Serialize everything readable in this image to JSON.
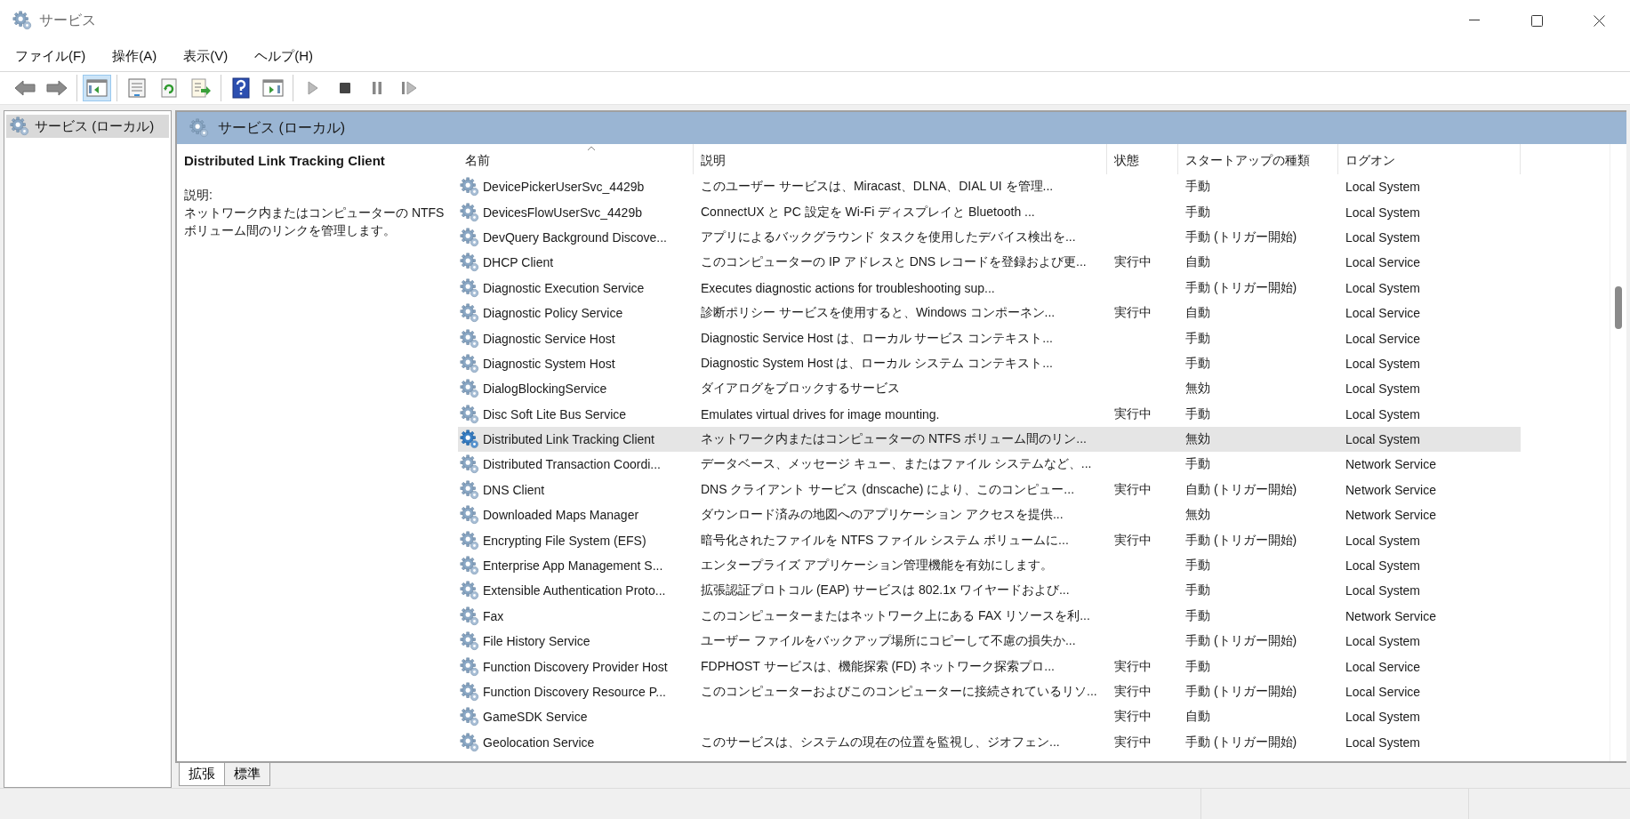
{
  "window": {
    "title": "サービス"
  },
  "menu": [
    "ファイル(F)",
    "操作(A)",
    "表示(V)",
    "ヘルプ(H)"
  ],
  "toolbar_groups": [
    {
      "buttons": [
        {
          "kind": "back",
          "pressed": false
        },
        {
          "kind": "forward",
          "pressed": false
        }
      ]
    },
    {
      "buttons": [
        {
          "kind": "console-tree",
          "pressed": true
        }
      ]
    },
    {
      "buttons": [
        {
          "kind": "properties",
          "pressed": false
        },
        {
          "kind": "refresh",
          "pressed": false
        },
        {
          "kind": "export",
          "pressed": false
        }
      ]
    },
    {
      "buttons": [
        {
          "kind": "help",
          "pressed": false
        },
        {
          "kind": "show-pane",
          "pressed": false
        }
      ]
    },
    {
      "buttons": [
        {
          "kind": "start",
          "pressed": false
        },
        {
          "kind": "stop",
          "pressed": false
        },
        {
          "kind": "pause",
          "pressed": false
        },
        {
          "kind": "resume",
          "pressed": false
        }
      ]
    }
  ],
  "tree": {
    "items": [
      {
        "label": "サービス (ローカル)",
        "selected": true
      }
    ]
  },
  "pane_header": "サービス (ローカル)",
  "details": {
    "title": "Distributed Link Tracking Client",
    "label": "説明:",
    "text": "ネットワーク内またはコンピューターの NTFS ボリューム間のリンクを管理します。"
  },
  "table": {
    "columns": [
      "名前",
      "説明",
      "状態",
      "スタートアップの種類",
      "ログオン"
    ],
    "rows": [
      {
        "name": "DevicePickerUserSvc_4429b",
        "description": "このユーザー サービスは、Miracast、DLNA、DIAL UI を管理...",
        "status": "",
        "startup": "手動",
        "logon": "Local System",
        "selected": false
      },
      {
        "name": "DevicesFlowUserSvc_4429b",
        "description": "ConnectUX と PC 設定を Wi-Fi ディスプレイと Bluetooth ...",
        "status": "",
        "startup": "手動",
        "logon": "Local System",
        "selected": false
      },
      {
        "name": "DevQuery Background Discove...",
        "description": "アプリによるバックグラウンド タスクを使用したデバイス検出を...",
        "status": "",
        "startup": "手動 (トリガー開始)",
        "logon": "Local System",
        "selected": false
      },
      {
        "name": "DHCP Client",
        "description": "このコンピューターの IP アドレスと DNS レコードを登録および更...",
        "status": "実行中",
        "startup": "自動",
        "logon": "Local Service",
        "selected": false
      },
      {
        "name": "Diagnostic Execution Service",
        "description": "Executes diagnostic actions for troubleshooting sup...",
        "status": "",
        "startup": "手動 (トリガー開始)",
        "logon": "Local System",
        "selected": false
      },
      {
        "name": "Diagnostic Policy Service",
        "description": "診断ポリシー サービスを使用すると、Windows コンポーネン...",
        "status": "実行中",
        "startup": "自動",
        "logon": "Local Service",
        "selected": false
      },
      {
        "name": "Diagnostic Service Host",
        "description": "Diagnostic Service Host は、ローカル サービス コンテキスト...",
        "status": "",
        "startup": "手動",
        "logon": "Local Service",
        "selected": false
      },
      {
        "name": "Diagnostic System Host",
        "description": "Diagnostic System Host は、ローカル システム コンテキスト...",
        "status": "",
        "startup": "手動",
        "logon": "Local System",
        "selected": false
      },
      {
        "name": "DialogBlockingService",
        "description": "ダイアログをブロックするサービス",
        "status": "",
        "startup": "無効",
        "logon": "Local System",
        "selected": false
      },
      {
        "name": "Disc Soft Lite Bus Service",
        "description": "Emulates virtual drives for image mounting.",
        "status": "実行中",
        "startup": "手動",
        "logon": "Local System",
        "selected": false
      },
      {
        "name": "Distributed Link Tracking Client",
        "description": "ネットワーク内またはコンピューターの NTFS ボリューム間のリン...",
        "status": "",
        "startup": "無効",
        "logon": "Local System",
        "selected": true
      },
      {
        "name": "Distributed Transaction Coordi...",
        "description": "データベース、メッセージ キュー、またはファイル システムなど、...",
        "status": "",
        "startup": "手動",
        "logon": "Network Service",
        "selected": false
      },
      {
        "name": "DNS Client",
        "description": "DNS クライアント サービス (dnscache) により、このコンピュー...",
        "status": "実行中",
        "startup": "自動 (トリガー開始)",
        "logon": "Network Service",
        "selected": false
      },
      {
        "name": "Downloaded Maps Manager",
        "description": "ダウンロード済みの地図へのアプリケーション アクセスを提供...",
        "status": "",
        "startup": "無効",
        "logon": "Network Service",
        "selected": false
      },
      {
        "name": "Encrypting File System (EFS)",
        "description": "暗号化されたファイルを NTFS ファイル システム ボリュームに...",
        "status": "実行中",
        "startup": "手動 (トリガー開始)",
        "logon": "Local System",
        "selected": false
      },
      {
        "name": "Enterprise App Management S...",
        "description": "エンタープライズ アプリケーション管理機能を有効にします。",
        "status": "",
        "startup": "手動",
        "logon": "Local System",
        "selected": false
      },
      {
        "name": "Extensible Authentication Proto...",
        "description": "拡張認証プロトコル (EAP) サービスは 802.1x ワイヤードおよび...",
        "status": "",
        "startup": "手動",
        "logon": "Local System",
        "selected": false
      },
      {
        "name": "Fax",
        "description": "このコンピューターまたはネットワーク上にある FAX リソースを利...",
        "status": "",
        "startup": "手動",
        "logon": "Network Service",
        "selected": false
      },
      {
        "name": "File History Service",
        "description": "ユーザー ファイルをバックアップ場所にコピーして不慮の損失か...",
        "status": "",
        "startup": "手動 (トリガー開始)",
        "logon": "Local System",
        "selected": false
      },
      {
        "name": "Function Discovery Provider Host",
        "description": "FDPHOST サービスは、機能探索 (FD) ネットワーク探索プロ...",
        "status": "実行中",
        "startup": "手動",
        "logon": "Local Service",
        "selected": false
      },
      {
        "name": "Function Discovery Resource P...",
        "description": "このコンピューターおよびこのコンピューターに接続されているリソ...",
        "status": "実行中",
        "startup": "手動 (トリガー開始)",
        "logon": "Local Service",
        "selected": false
      },
      {
        "name": "GameSDK Service",
        "description": "",
        "status": "実行中",
        "startup": "自動",
        "logon": "Local System",
        "selected": false
      },
      {
        "name": "Geolocation Service",
        "description": "このサービスは、システムの現在の位置を監視し、ジオフェン...",
        "status": "実行中",
        "startup": "手動 (トリガー開始)",
        "logon": "Local System",
        "selected": false
      }
    ]
  },
  "view_tabs": [
    {
      "label": "拡張",
      "selected": true
    },
    {
      "label": "標準",
      "selected": false
    }
  ]
}
